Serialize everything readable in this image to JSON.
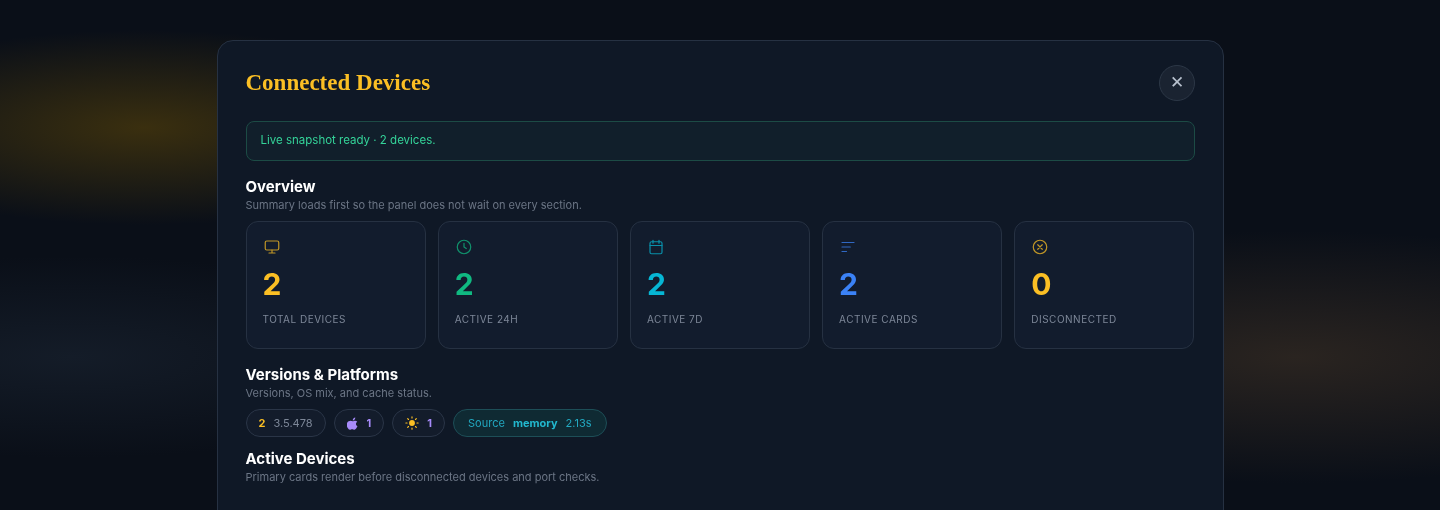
{
  "dialog": {
    "title": "Connected Devices",
    "close_label": "✕"
  },
  "banner": {
    "text": "Live snapshot ready · 2 devices."
  },
  "overview": {
    "heading": "Overview",
    "subtitle": "Summary loads first so the panel does not wait on every section.",
    "stats": [
      {
        "kind": "monitor",
        "value": "2",
        "label": "TOTAL DEVICES",
        "color": "#fbbf24"
      },
      {
        "kind": "clock",
        "value": "2",
        "label": "ACTIVE 24H",
        "color": "#10b981"
      },
      {
        "kind": "calendar",
        "value": "2",
        "label": "ACTIVE 7D",
        "color": "#06b6d4"
      },
      {
        "kind": "list",
        "value": "2",
        "label": "ACTIVE CARDS",
        "color": "#3b82f6"
      },
      {
        "kind": "x-circle",
        "value": "0",
        "label": "DISCONNECTED",
        "color": "#fbbf24"
      }
    ]
  },
  "versions": {
    "heading": "Versions & Platforms",
    "subtitle": "Versions, OS mix, and cache status.",
    "chips": [
      {
        "kind": "version",
        "count": "2",
        "text": "3.5.478"
      },
      {
        "kind": "apple",
        "count": "1"
      },
      {
        "kind": "sun",
        "count": "1"
      },
      {
        "kind": "source",
        "label": "Source",
        "value": "memory",
        "time": "2.13s"
      }
    ]
  },
  "active_devices": {
    "heading": "Active Devices",
    "subtitle": "Primary cards render before disconnected devices and port checks."
  }
}
